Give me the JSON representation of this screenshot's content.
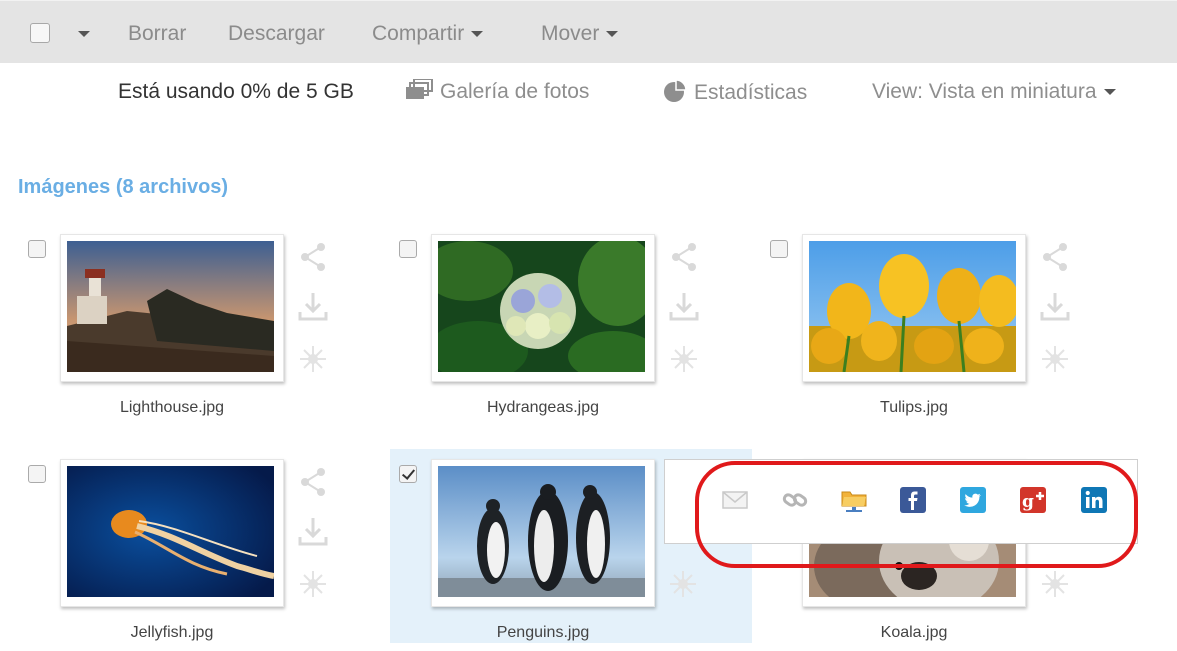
{
  "toolbar": {
    "delete_label": "Borrar",
    "download_label": "Descargar",
    "share_label": "Compartir",
    "move_label": "Mover"
  },
  "info": {
    "usage_text": "Está usando 0% de 5 GB",
    "gallery_label": "Galería de fotos",
    "stats_label": "Estadísticas",
    "view_label": "View: Vista en miniatura"
  },
  "section": {
    "title": "Imágenes (8 archivos)"
  },
  "files": [
    {
      "name": "Lighthouse.jpg",
      "checked": false
    },
    {
      "name": "Hydrangeas.jpg",
      "checked": false
    },
    {
      "name": "Tulips.jpg",
      "checked": false
    },
    {
      "name": "Jellyfish.jpg",
      "checked": false
    },
    {
      "name": "Penguins.jpg",
      "checked": true
    },
    {
      "name": "Koala.jpg",
      "checked": false
    }
  ],
  "share_menu": {
    "items": [
      "email-icon",
      "link-icon",
      "folder-share-icon",
      "facebook-icon",
      "twitter-icon",
      "google-plus-icon",
      "linkedin-icon"
    ]
  },
  "colors": {
    "accent": "#6aaee4",
    "highlight_ring": "#e0191b",
    "selected_tile": "#e4f1fa"
  }
}
